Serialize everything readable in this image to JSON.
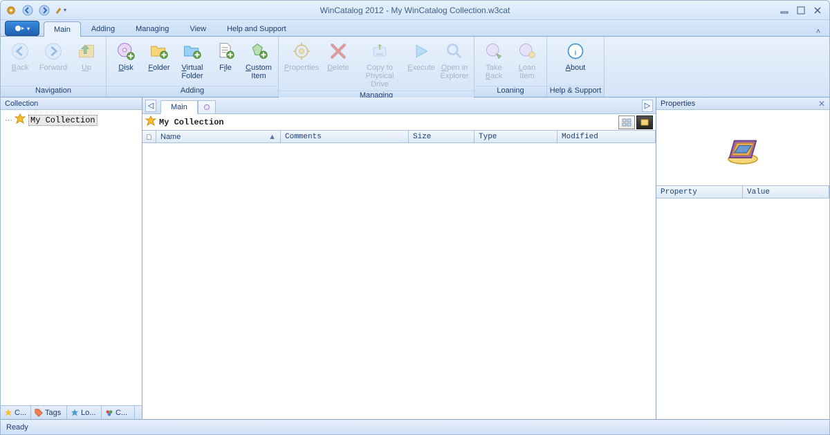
{
  "title": "WinCatalog 2012 - My WinCatalog Collection.w3cat",
  "tabs": {
    "main": "Main",
    "adding": "Adding",
    "managing": "Managing",
    "view": "View",
    "help": "Help and Support"
  },
  "ribbon": {
    "nav": {
      "back": "Back",
      "forward": "Forward",
      "up": "Up",
      "group": "Navigation"
    },
    "add": {
      "disk": "Disk",
      "folder": "Folder",
      "vfolder": "Virtual\nFolder",
      "file": "File",
      "custom": "Custom\nItem",
      "group": "Adding"
    },
    "mng": {
      "props": "Properties",
      "del": "Delete",
      "copy": "Copy to\nPhysical Drive",
      "exec": "Execute",
      "open": "Open in\nExplorer",
      "group": "Managing"
    },
    "loan": {
      "take": "Take\nBack",
      "loan": "Loan\nItem",
      "group": "Loaning"
    },
    "hs": {
      "about": "About",
      "group": "Help & Support"
    }
  },
  "left": {
    "header": "Collection",
    "root": "My Collection",
    "btabs": {
      "c": "C...",
      "tags": "Tags",
      "lo": "Lo...",
      "co": "C..."
    }
  },
  "center": {
    "tab_main": "Main",
    "path": "My Collection",
    "cols": {
      "icon": "",
      "name": "Name",
      "comments": "Comments",
      "size": "Size",
      "type": "Type",
      "modified": "Modified"
    }
  },
  "right": {
    "header": "Properties",
    "cols": {
      "prop": "Property",
      "val": "Value"
    }
  },
  "status": "Ready"
}
